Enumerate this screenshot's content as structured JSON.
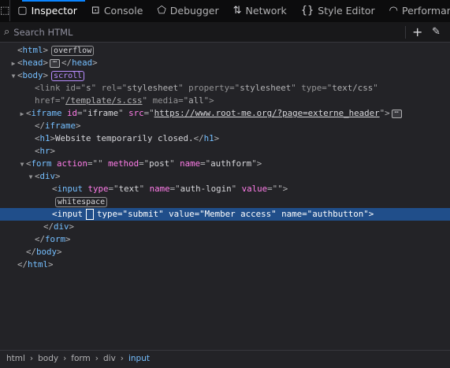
{
  "toolbar": {
    "tabs": [
      {
        "label": "Inspector",
        "icon": "inspector-icon",
        "glyph": "▢",
        "active": true
      },
      {
        "label": "Console",
        "icon": "console-icon",
        "glyph": "⊡"
      },
      {
        "label": "Debugger",
        "icon": "debugger-icon",
        "glyph": "⬠"
      },
      {
        "label": "Network",
        "icon": "network-icon",
        "glyph": "⇅"
      },
      {
        "label": "Style Editor",
        "icon": "style-editor-icon",
        "glyph": "{}"
      },
      {
        "label": "Performance",
        "icon": "performance-icon",
        "glyph": "◠"
      }
    ]
  },
  "search": {
    "placeholder": "Search HTML"
  },
  "tree": [
    {
      "i": 0,
      "tw": "",
      "tok": [
        [
          "p",
          "<"
        ],
        [
          "t",
          "html"
        ],
        [
          "p",
          ">"
        ],
        [
          "badge",
          "overflow"
        ]
      ]
    },
    {
      "i": 0,
      "tw": "closed",
      "tok": [
        [
          "p",
          "<"
        ],
        [
          "t",
          "head"
        ],
        [
          "p",
          ">"
        ],
        [
          "more",
          "⋯"
        ],
        [
          "p",
          "</"
        ],
        [
          "t",
          "head"
        ],
        [
          "p",
          ">"
        ]
      ]
    },
    {
      "i": 0,
      "tw": "open",
      "tok": [
        [
          "p",
          "<"
        ],
        [
          "t",
          "body"
        ],
        [
          "p",
          ">"
        ],
        [
          "badge-scroll",
          "scroll"
        ]
      ]
    },
    {
      "i": 2,
      "tw": "",
      "dim": true,
      "tok": [
        [
          "p",
          "<"
        ],
        [
          "t",
          "link"
        ],
        [
          "a",
          " id"
        ],
        [
          "p",
          "=\""
        ],
        [
          "v",
          "s"
        ],
        [
          "p",
          "\""
        ],
        [
          "a",
          " rel"
        ],
        [
          "p",
          "=\""
        ],
        [
          "v",
          "stylesheet"
        ],
        [
          "p",
          "\""
        ],
        [
          "a",
          " property"
        ],
        [
          "p",
          "=\""
        ],
        [
          "v",
          "stylesheet"
        ],
        [
          "p",
          "\""
        ],
        [
          "a",
          " type"
        ],
        [
          "p",
          "=\""
        ],
        [
          "v",
          "text/css"
        ],
        [
          "p",
          "\""
        ]
      ]
    },
    {
      "i": 2,
      "tw": "",
      "dim": true,
      "tok": [
        [
          "a",
          "href"
        ],
        [
          "p",
          "=\""
        ],
        [
          "u",
          "/template/s.css"
        ],
        [
          "p",
          "\""
        ],
        [
          "a",
          " media"
        ],
        [
          "p",
          "=\""
        ],
        [
          "v",
          "all"
        ],
        [
          "p",
          "\">"
        ]
      ]
    },
    {
      "i": 1,
      "tw": "closed",
      "tok": [
        [
          "p",
          "<"
        ],
        [
          "t",
          "iframe"
        ],
        [
          "a",
          " id"
        ],
        [
          "p",
          "=\""
        ],
        [
          "v",
          "iframe"
        ],
        [
          "p",
          "\""
        ],
        [
          "a",
          " src"
        ],
        [
          "p",
          "=\""
        ],
        [
          "u",
          "https://www.root-me.org/?page=externe_header"
        ],
        [
          "p",
          "\">"
        ],
        [
          "more",
          "⋯"
        ]
      ]
    },
    {
      "i": 2,
      "tw": "",
      "tok": [
        [
          "p",
          "</"
        ],
        [
          "t",
          "iframe"
        ],
        [
          "p",
          ">"
        ]
      ]
    },
    {
      "i": 2,
      "tw": "",
      "tok": [
        [
          "p",
          "<"
        ],
        [
          "t",
          "h1"
        ],
        [
          "p",
          ">"
        ],
        [
          "x",
          "Website temporarily closed."
        ],
        [
          "p",
          "</"
        ],
        [
          "t",
          "h1"
        ],
        [
          "p",
          ">"
        ]
      ]
    },
    {
      "i": 2,
      "tw": "",
      "tok": [
        [
          "p",
          "<"
        ],
        [
          "t",
          "hr"
        ],
        [
          "p",
          ">"
        ]
      ]
    },
    {
      "i": 1,
      "tw": "open",
      "tok": [
        [
          "p",
          "<"
        ],
        [
          "t",
          "form"
        ],
        [
          "a",
          " action"
        ],
        [
          "p",
          "=\""
        ],
        [
          "v",
          ""
        ],
        [
          "p",
          "\""
        ],
        [
          "a",
          " method"
        ],
        [
          "p",
          "=\""
        ],
        [
          "v",
          "post"
        ],
        [
          "p",
          "\""
        ],
        [
          "a",
          " name"
        ],
        [
          "p",
          "=\""
        ],
        [
          "v",
          "authform"
        ],
        [
          "p",
          "\">"
        ]
      ]
    },
    {
      "i": 2,
      "tw": "open",
      "tok": [
        [
          "p",
          "<"
        ],
        [
          "t",
          "div"
        ],
        [
          "p",
          ">"
        ]
      ]
    },
    {
      "i": 4,
      "tw": "",
      "tok": [
        [
          "p",
          "<"
        ],
        [
          "t",
          "input"
        ],
        [
          "a",
          " type"
        ],
        [
          "p",
          "=\""
        ],
        [
          "v",
          "text"
        ],
        [
          "p",
          "\""
        ],
        [
          "a",
          " name"
        ],
        [
          "p",
          "=\""
        ],
        [
          "v",
          "auth-login"
        ],
        [
          "p",
          "\""
        ],
        [
          "a",
          " value"
        ],
        [
          "p",
          "=\""
        ],
        [
          "v",
          ""
        ],
        [
          "p",
          "\">"
        ]
      ]
    },
    {
      "i": 4,
      "tw": "",
      "tok": [
        [
          "badge0",
          "whitespace"
        ]
      ]
    },
    {
      "i": 4,
      "tw": "",
      "sel": true,
      "tok": [
        [
          "p",
          "<"
        ],
        [
          "t",
          "input"
        ],
        [
          "caret",
          ""
        ],
        [
          "a",
          "type"
        ],
        [
          "p",
          "=\""
        ],
        [
          "v",
          "submit"
        ],
        [
          "p",
          "\""
        ],
        [
          "a",
          " value"
        ],
        [
          "p",
          "=\""
        ],
        [
          "v",
          "Member access"
        ],
        [
          "p",
          "\""
        ],
        [
          "a",
          " name"
        ],
        [
          "p",
          "=\""
        ],
        [
          "v",
          "authbutton"
        ],
        [
          "p",
          "\">"
        ]
      ]
    },
    {
      "i": 3,
      "tw": "",
      "tok": [
        [
          "p",
          "</"
        ],
        [
          "t",
          "div"
        ],
        [
          "p",
          ">"
        ]
      ]
    },
    {
      "i": 2,
      "tw": "",
      "tok": [
        [
          "p",
          "</"
        ],
        [
          "t",
          "form"
        ],
        [
          "p",
          ">"
        ]
      ]
    },
    {
      "i": 1,
      "tw": "",
      "tok": [
        [
          "p",
          "</"
        ],
        [
          "t",
          "body"
        ],
        [
          "p",
          ">"
        ]
      ]
    },
    {
      "i": 0,
      "tw": "",
      "tok": [
        [
          "p",
          "</"
        ],
        [
          "t",
          "html"
        ],
        [
          "p",
          ">"
        ]
      ]
    }
  ],
  "breadcrumbs": [
    "html",
    "body",
    "form",
    "div",
    "input"
  ],
  "breadcrumb_separator": "›"
}
